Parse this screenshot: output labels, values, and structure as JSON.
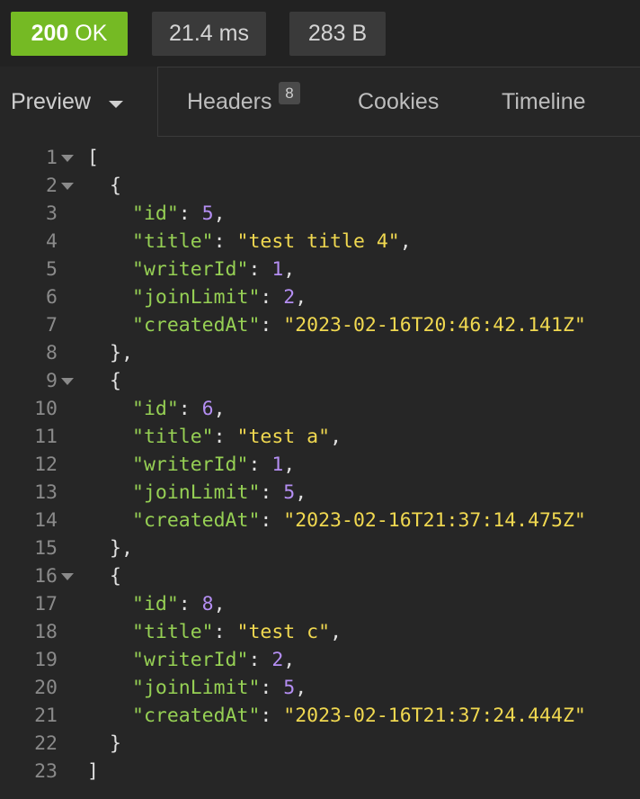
{
  "status": {
    "code": "200",
    "text": "OK",
    "time": "21.4 ms",
    "size": "283 B"
  },
  "tabs": {
    "preview": "Preview",
    "headers": "Headers",
    "headers_count": "8",
    "cookies": "Cookies",
    "timeline": "Timeline"
  },
  "colors": {
    "ok_green": "#75ba24",
    "key": "#96d054",
    "string": "#f0d850",
    "number": "#b48ef2"
  },
  "icons": {
    "dropdown": "chevron-down-icon",
    "fold": "fold-arrow-icon"
  },
  "code_lines": [
    {
      "n": "1",
      "fold": true,
      "indent": 0,
      "tokens": [
        [
          "pun",
          "["
        ]
      ]
    },
    {
      "n": "2",
      "fold": true,
      "indent": 1,
      "tokens": [
        [
          "pun",
          "{"
        ]
      ]
    },
    {
      "n": "3",
      "fold": false,
      "indent": 2,
      "tokens": [
        [
          "key",
          "\"id\""
        ],
        [
          "pun",
          ": "
        ],
        [
          "num",
          "5"
        ],
        [
          "pun",
          ","
        ]
      ]
    },
    {
      "n": "4",
      "fold": false,
      "indent": 2,
      "tokens": [
        [
          "key",
          "\"title\""
        ],
        [
          "pun",
          ": "
        ],
        [
          "str",
          "\"test title 4\""
        ],
        [
          "pun",
          ","
        ]
      ]
    },
    {
      "n": "5",
      "fold": false,
      "indent": 2,
      "tokens": [
        [
          "key",
          "\"writerId\""
        ],
        [
          "pun",
          ": "
        ],
        [
          "num",
          "1"
        ],
        [
          "pun",
          ","
        ]
      ]
    },
    {
      "n": "6",
      "fold": false,
      "indent": 2,
      "tokens": [
        [
          "key",
          "\"joinLimit\""
        ],
        [
          "pun",
          ": "
        ],
        [
          "num",
          "2"
        ],
        [
          "pun",
          ","
        ]
      ]
    },
    {
      "n": "7",
      "fold": false,
      "indent": 2,
      "tokens": [
        [
          "key",
          "\"createdAt\""
        ],
        [
          "pun",
          ": "
        ],
        [
          "str",
          "\"2023-02-16T20:46:42.141Z\""
        ]
      ]
    },
    {
      "n": "8",
      "fold": false,
      "indent": 1,
      "tokens": [
        [
          "pun",
          "},"
        ]
      ]
    },
    {
      "n": "9",
      "fold": true,
      "indent": 1,
      "tokens": [
        [
          "pun",
          "{"
        ]
      ]
    },
    {
      "n": "10",
      "fold": false,
      "indent": 2,
      "tokens": [
        [
          "key",
          "\"id\""
        ],
        [
          "pun",
          ": "
        ],
        [
          "num",
          "6"
        ],
        [
          "pun",
          ","
        ]
      ]
    },
    {
      "n": "11",
      "fold": false,
      "indent": 2,
      "tokens": [
        [
          "key",
          "\"title\""
        ],
        [
          "pun",
          ": "
        ],
        [
          "str",
          "\"test a\""
        ],
        [
          "pun",
          ","
        ]
      ]
    },
    {
      "n": "12",
      "fold": false,
      "indent": 2,
      "tokens": [
        [
          "key",
          "\"writerId\""
        ],
        [
          "pun",
          ": "
        ],
        [
          "num",
          "1"
        ],
        [
          "pun",
          ","
        ]
      ]
    },
    {
      "n": "13",
      "fold": false,
      "indent": 2,
      "tokens": [
        [
          "key",
          "\"joinLimit\""
        ],
        [
          "pun",
          ": "
        ],
        [
          "num",
          "5"
        ],
        [
          "pun",
          ","
        ]
      ]
    },
    {
      "n": "14",
      "fold": false,
      "indent": 2,
      "tokens": [
        [
          "key",
          "\"createdAt\""
        ],
        [
          "pun",
          ": "
        ],
        [
          "str",
          "\"2023-02-16T21:37:14.475Z\""
        ]
      ]
    },
    {
      "n": "15",
      "fold": false,
      "indent": 1,
      "tokens": [
        [
          "pun",
          "},"
        ]
      ]
    },
    {
      "n": "16",
      "fold": true,
      "indent": 1,
      "tokens": [
        [
          "pun",
          "{"
        ]
      ]
    },
    {
      "n": "17",
      "fold": false,
      "indent": 2,
      "tokens": [
        [
          "key",
          "\"id\""
        ],
        [
          "pun",
          ": "
        ],
        [
          "num",
          "8"
        ],
        [
          "pun",
          ","
        ]
      ]
    },
    {
      "n": "18",
      "fold": false,
      "indent": 2,
      "tokens": [
        [
          "key",
          "\"title\""
        ],
        [
          "pun",
          ": "
        ],
        [
          "str",
          "\"test c\""
        ],
        [
          "pun",
          ","
        ]
      ]
    },
    {
      "n": "19",
      "fold": false,
      "indent": 2,
      "tokens": [
        [
          "key",
          "\"writerId\""
        ],
        [
          "pun",
          ": "
        ],
        [
          "num",
          "2"
        ],
        [
          "pun",
          ","
        ]
      ]
    },
    {
      "n": "20",
      "fold": false,
      "indent": 2,
      "tokens": [
        [
          "key",
          "\"joinLimit\""
        ],
        [
          "pun",
          ": "
        ],
        [
          "num",
          "5"
        ],
        [
          "pun",
          ","
        ]
      ]
    },
    {
      "n": "21",
      "fold": false,
      "indent": 2,
      "tokens": [
        [
          "key",
          "\"createdAt\""
        ],
        [
          "pun",
          ": "
        ],
        [
          "str",
          "\"2023-02-16T21:37:24.444Z\""
        ]
      ]
    },
    {
      "n": "22",
      "fold": false,
      "indent": 1,
      "tokens": [
        [
          "pun",
          "}"
        ]
      ]
    },
    {
      "n": "23",
      "fold": false,
      "indent": 0,
      "tokens": [
        [
          "pun",
          "]"
        ]
      ]
    }
  ]
}
